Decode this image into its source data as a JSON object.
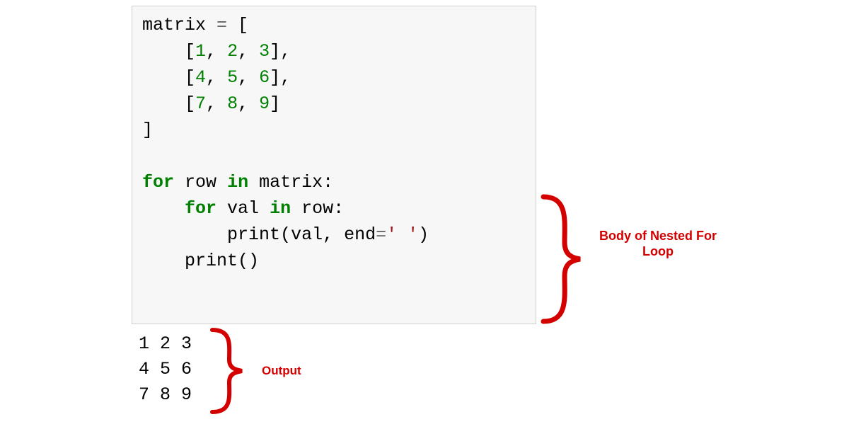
{
  "code": {
    "line1_var": "matrix",
    "line1_op": " = ",
    "line1_bracket": "[",
    "row1_open": "[",
    "row1_n1": "1",
    "row1_c1": ", ",
    "row1_n2": "2",
    "row1_c2": ", ",
    "row1_n3": "3",
    "row1_close": "],",
    "row2_open": "[",
    "row2_n1": "4",
    "row2_c1": ", ",
    "row2_n2": "5",
    "row2_c2": ", ",
    "row2_n3": "6",
    "row2_close": "],",
    "row3_open": "[",
    "row3_n1": "7",
    "row3_c1": ", ",
    "row3_n2": "8",
    "row3_c2": ", ",
    "row3_n3": "9",
    "row3_close": "]",
    "close_bracket": "]",
    "blank": "",
    "for1_kw1": "for",
    "for1_sp1": " ",
    "for1_var1": "row",
    "for1_sp2": " ",
    "for1_kw2": "in",
    "for1_sp3": " ",
    "for1_var2": "matrix",
    "for1_colon": ":",
    "for2_kw1": "for",
    "for2_sp1": " ",
    "for2_var1": "val",
    "for2_sp2": " ",
    "for2_kw2": "in",
    "for2_sp3": " ",
    "for2_var2": "row",
    "for2_colon": ":",
    "print1_fn": "print",
    "print1_open": "(",
    "print1_arg1": "val",
    "print1_comma": ", ",
    "print1_kw": "end",
    "print1_eq": "=",
    "print1_str": "' '",
    "print1_close": ")",
    "print2_fn": "print",
    "print2_parens": "()",
    "indent1": "    ",
    "indent2": "        "
  },
  "output": {
    "line1": "1 2 3",
    "line2": "4 5 6",
    "line3": "7 8 9"
  },
  "annotations": {
    "loop_body": "Body of Nested For Loop",
    "output_label": "Output"
  }
}
